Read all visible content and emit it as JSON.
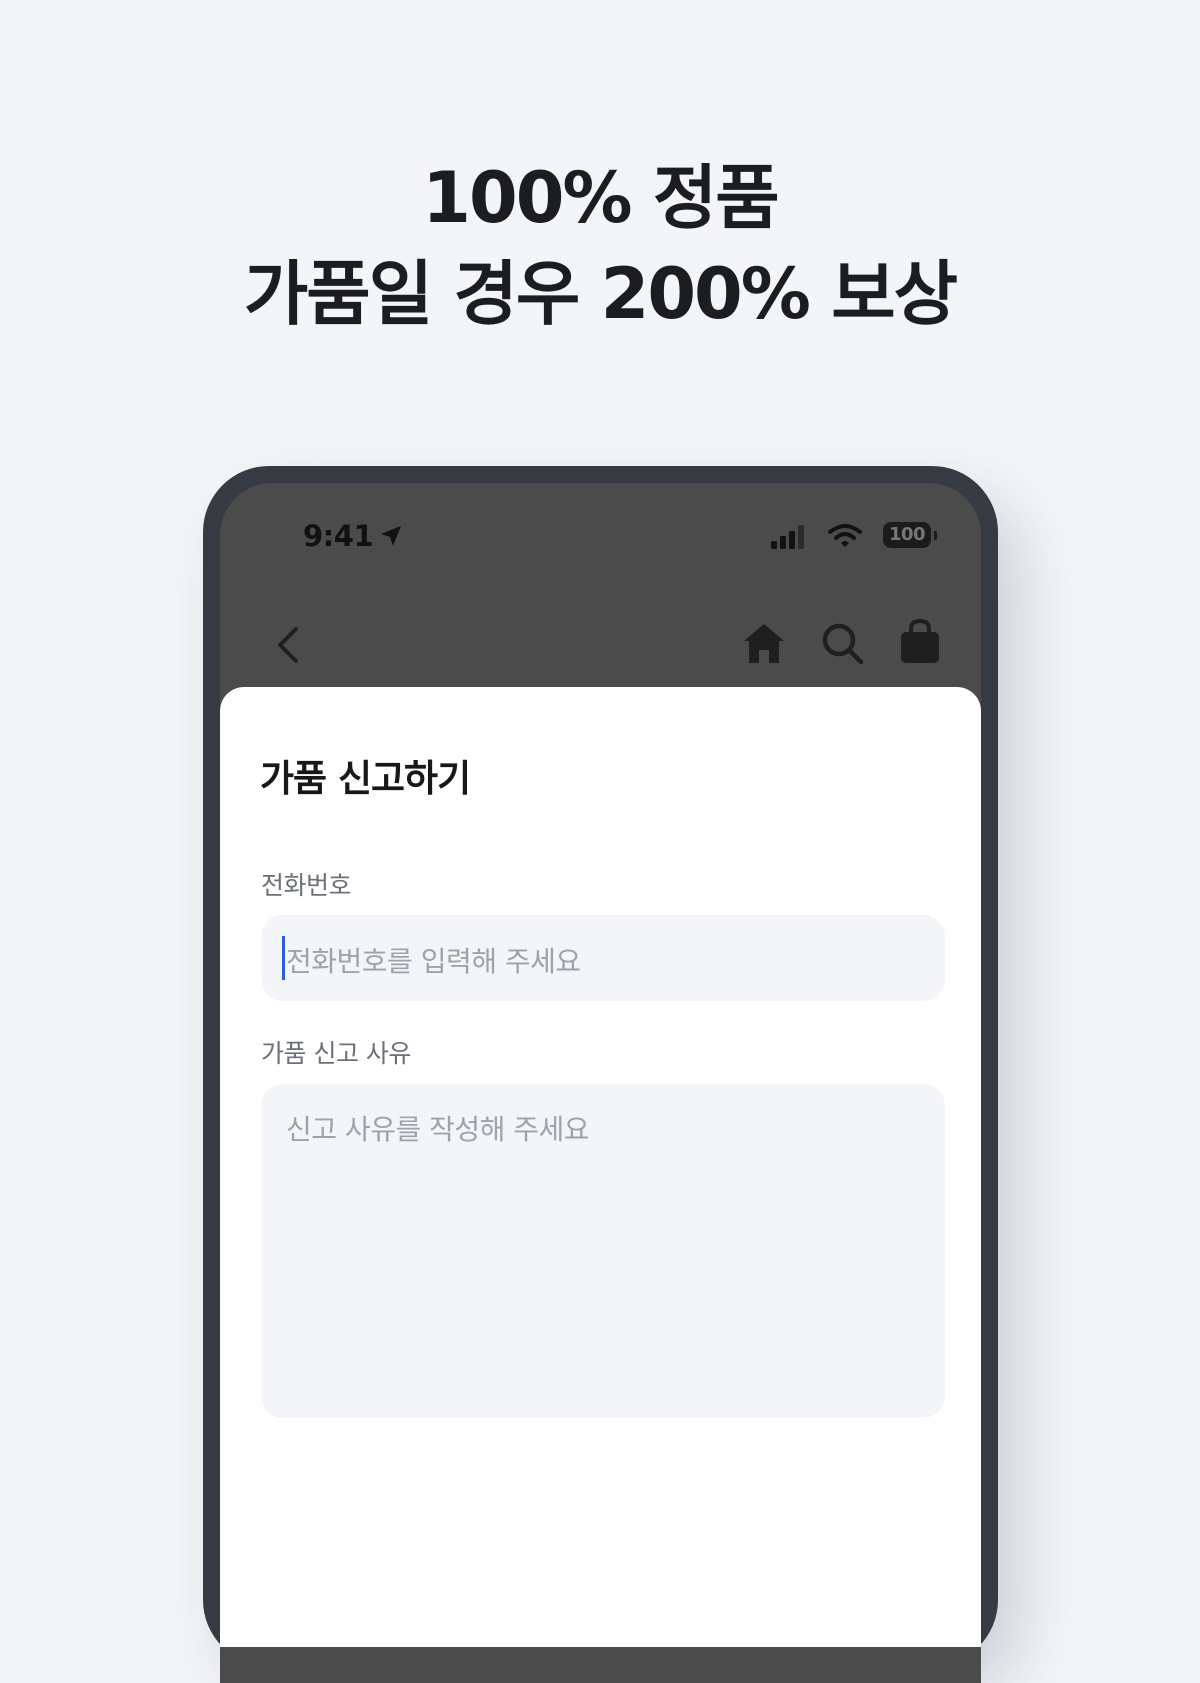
{
  "headline": {
    "line1": "100% 정품",
    "line2": "가품일 경우 200% 보상"
  },
  "status_bar": {
    "time": "9:41",
    "battery": "100",
    "icons": [
      "location-arrow-icon",
      "cellular-signal-icon",
      "wifi-icon",
      "battery-icon"
    ]
  },
  "nav_bar": {
    "icons": [
      "back-chevron-icon",
      "home-icon",
      "search-icon",
      "shopping-bag-icon"
    ]
  },
  "form": {
    "title": "가품 신고하기",
    "phone": {
      "label": "전화번호",
      "placeholder": "전화번호를 입력해 주세요",
      "value": ""
    },
    "reason": {
      "label": "가품 신고 사유",
      "placeholder": "신고 사유를 작성해 주세요",
      "value": ""
    }
  },
  "colors": {
    "page_background": "#f3f5f8",
    "phone_frame": "#363a43",
    "screen_overlay": "#4b4b4b",
    "input_background": "#f3f5f8",
    "caret": "#2f5fe0"
  }
}
